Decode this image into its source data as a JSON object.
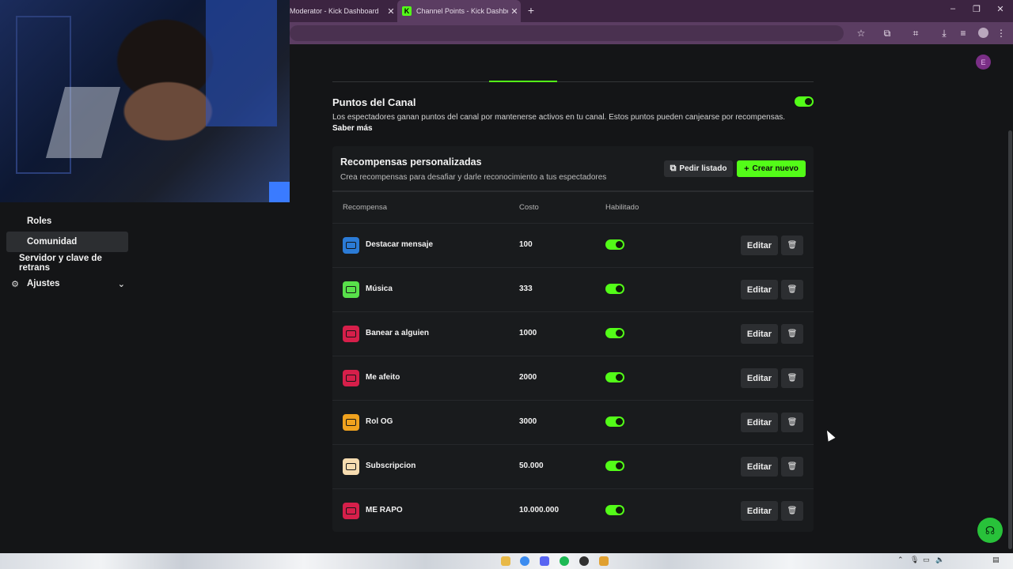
{
  "browser": {
    "tabs": [
      {
        "label": "Moderator - Kick Dashboard",
        "active": false
      },
      {
        "label": "Channel Points - Kick Dashboar",
        "active": true
      }
    ],
    "new_tab_icon": "plus-icon"
  },
  "sidebar": {
    "items": [
      {
        "label": "Roles",
        "selected": false
      },
      {
        "label": "Comunidad",
        "selected": true
      },
      {
        "label": "Servidor y clave de retrans",
        "selected": false
      },
      {
        "label": "Ajustes",
        "selected": false,
        "icon": "gear-icon",
        "expandable": true
      }
    ]
  },
  "channel_points": {
    "title": "Puntos del Canal",
    "description": "Los espectadores ganan puntos del canal por mantenerse activos en tu canal. Estos puntos pueden canjearse por recompensas.",
    "learn_more": "Saber más",
    "enabled": true
  },
  "rewards": {
    "title": "Recompensas personalizadas",
    "subtitle": "Crea recompensas para desafiar y darle reconocimiento a tus espectadores",
    "list_button": "Pedir listado",
    "create_button": "Crear nuevo",
    "columns": {
      "reward": "Recompensa",
      "cost": "Costo",
      "enabled": "Habilitado"
    },
    "edit_label": "Editar",
    "items": [
      {
        "name": "Destacar mensaje",
        "cost": "100",
        "enabled": true,
        "color": "#2b7bd6"
      },
      {
        "name": "Música",
        "cost": "333",
        "enabled": true,
        "color": "#58e04a"
      },
      {
        "name": "Banear a alguien",
        "cost": "1000",
        "enabled": true,
        "color": "#d61f4a"
      },
      {
        "name": "Me afeito",
        "cost": "2000",
        "enabled": true,
        "color": "#d61f4a"
      },
      {
        "name": "Rol OG",
        "cost": "3000",
        "enabled": true,
        "color": "#f0a21e"
      },
      {
        "name": "Subscripcion",
        "cost": "50.000",
        "enabled": true,
        "color": "#f6dcb0"
      },
      {
        "name": "ME RAPO",
        "cost": "10.000.000",
        "enabled": true,
        "color": "#d61f4a"
      }
    ]
  },
  "colors": {
    "accent": "#53fc18",
    "background": "#141517",
    "panel": "#191b1d"
  }
}
